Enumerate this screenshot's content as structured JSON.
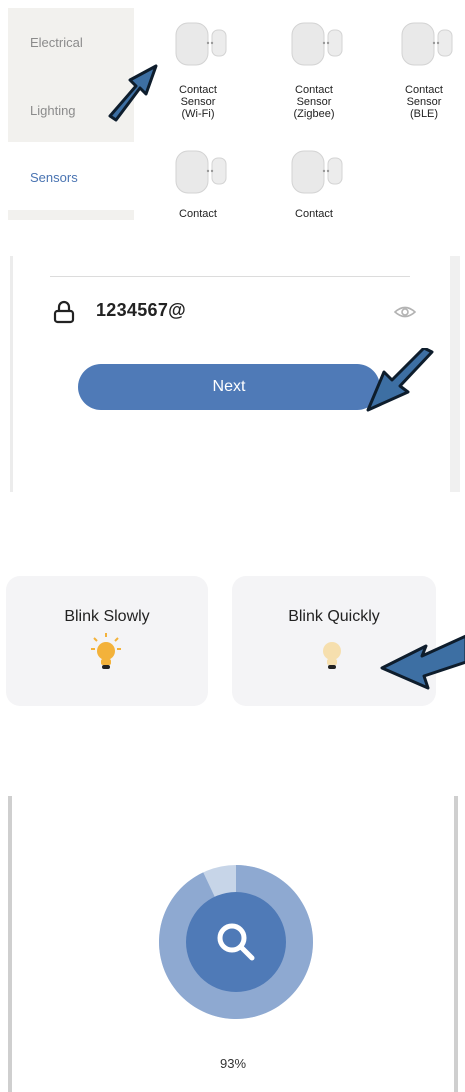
{
  "categories": {
    "items": [
      {
        "label": "Electrical"
      },
      {
        "label": "Lighting"
      },
      {
        "label": "Sensors"
      }
    ],
    "devices": [
      {
        "label": "Contact\nSensor\n(Wi-Fi)"
      },
      {
        "label": "Contact\nSensor\n(Zigbee)"
      },
      {
        "label": "Contact\nSensor\n(BLE)"
      },
      {
        "label": "Contact"
      },
      {
        "label": "Contact"
      }
    ]
  },
  "password": {
    "value": "1234567@",
    "next_label": "Next"
  },
  "blink": {
    "slow_label": "Blink Slowly",
    "quick_label": "Blink Quickly"
  },
  "progress": {
    "percent_text": "93%",
    "value": 0.93
  },
  "colors": {
    "accent_blue": "#4f7ab7",
    "bulb_on": "#f3b23b",
    "bulb_dim": "#f6dfae"
  },
  "icons": [
    "arrow-pointer-icon",
    "lock-icon",
    "eye-icon",
    "bulb-icon",
    "search-icon"
  ]
}
